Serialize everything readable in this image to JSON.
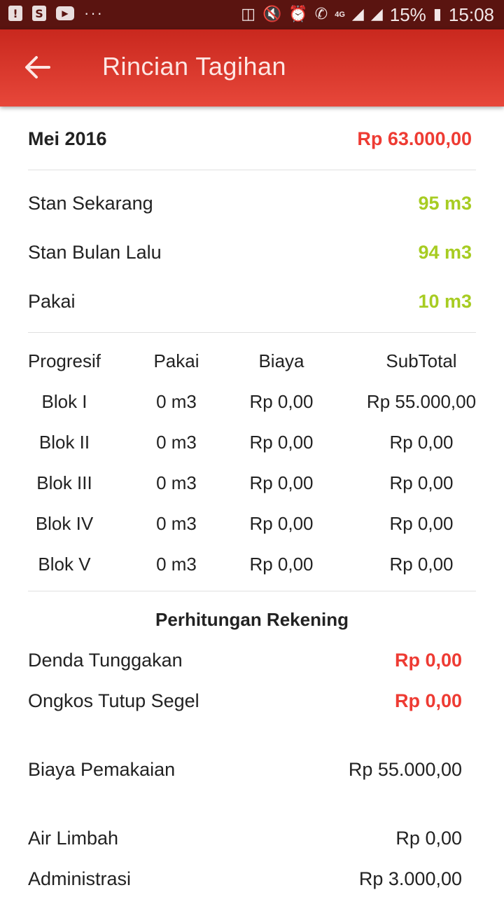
{
  "status_bar": {
    "time": "15:08",
    "battery": "15%",
    "network": "4G",
    "icons_left": [
      "alert-icon",
      "shopping-bag-icon",
      "youtube-icon",
      "more-dots-icon"
    ],
    "icons_right": [
      "cast-icon",
      "vibrate-mute-icon",
      "alarm-icon",
      "phone-icon",
      "signal-icon",
      "wifi-icon",
      "battery-icon"
    ]
  },
  "app_bar": {
    "title": "Rincian Tagihan",
    "back_icon": "arrow-back-icon",
    "color_start": "#c9281e",
    "color_end": "#e7473a"
  },
  "summary": {
    "period": "Mei 2016",
    "total": "Rp 63.000,00"
  },
  "meter": {
    "current_label": "Stan Sekarang",
    "current_value": "95 m3",
    "previous_label": "Stan Bulan Lalu",
    "previous_value": "94 m3",
    "usage_label": "Pakai",
    "usage_value": "10 m3"
  },
  "progressive_table": {
    "headers": [
      "Progresif",
      "Pakai",
      "Biaya",
      "SubTotal"
    ],
    "rows": [
      [
        "Blok I",
        "0 m3",
        "Rp 0,00",
        "Rp 55.000,00"
      ],
      [
        "Blok II",
        "0 m3",
        "Rp 0,00",
        "Rp 0,00"
      ],
      [
        "Blok III",
        "0 m3",
        "Rp 0,00",
        "Rp 0,00"
      ],
      [
        "Blok IV",
        "0 m3",
        "Rp 0,00",
        "Rp 0,00"
      ],
      [
        "Blok V",
        "0 m3",
        "Rp 0,00",
        "Rp 0,00"
      ]
    ]
  },
  "calculation": {
    "title": "Perhitungan Rekening",
    "penalty_label": "Denda Tunggakan",
    "penalty_value": "Rp 0,00",
    "seal_label": "Ongkos Tutup Segel",
    "seal_value": "Rp 0,00",
    "usage_cost_label": "Biaya Pemakaian",
    "usage_cost_value": "Rp 55.000,00",
    "waste_water_label": "Air Limbah",
    "waste_water_value": "Rp 0,00",
    "admin_label": "Administrasi",
    "admin_value": "Rp 3.000,00"
  },
  "colors": {
    "accent_red": "#ee3b33",
    "accent_green": "#a7cc22",
    "status_bar": "#5a1410"
  }
}
